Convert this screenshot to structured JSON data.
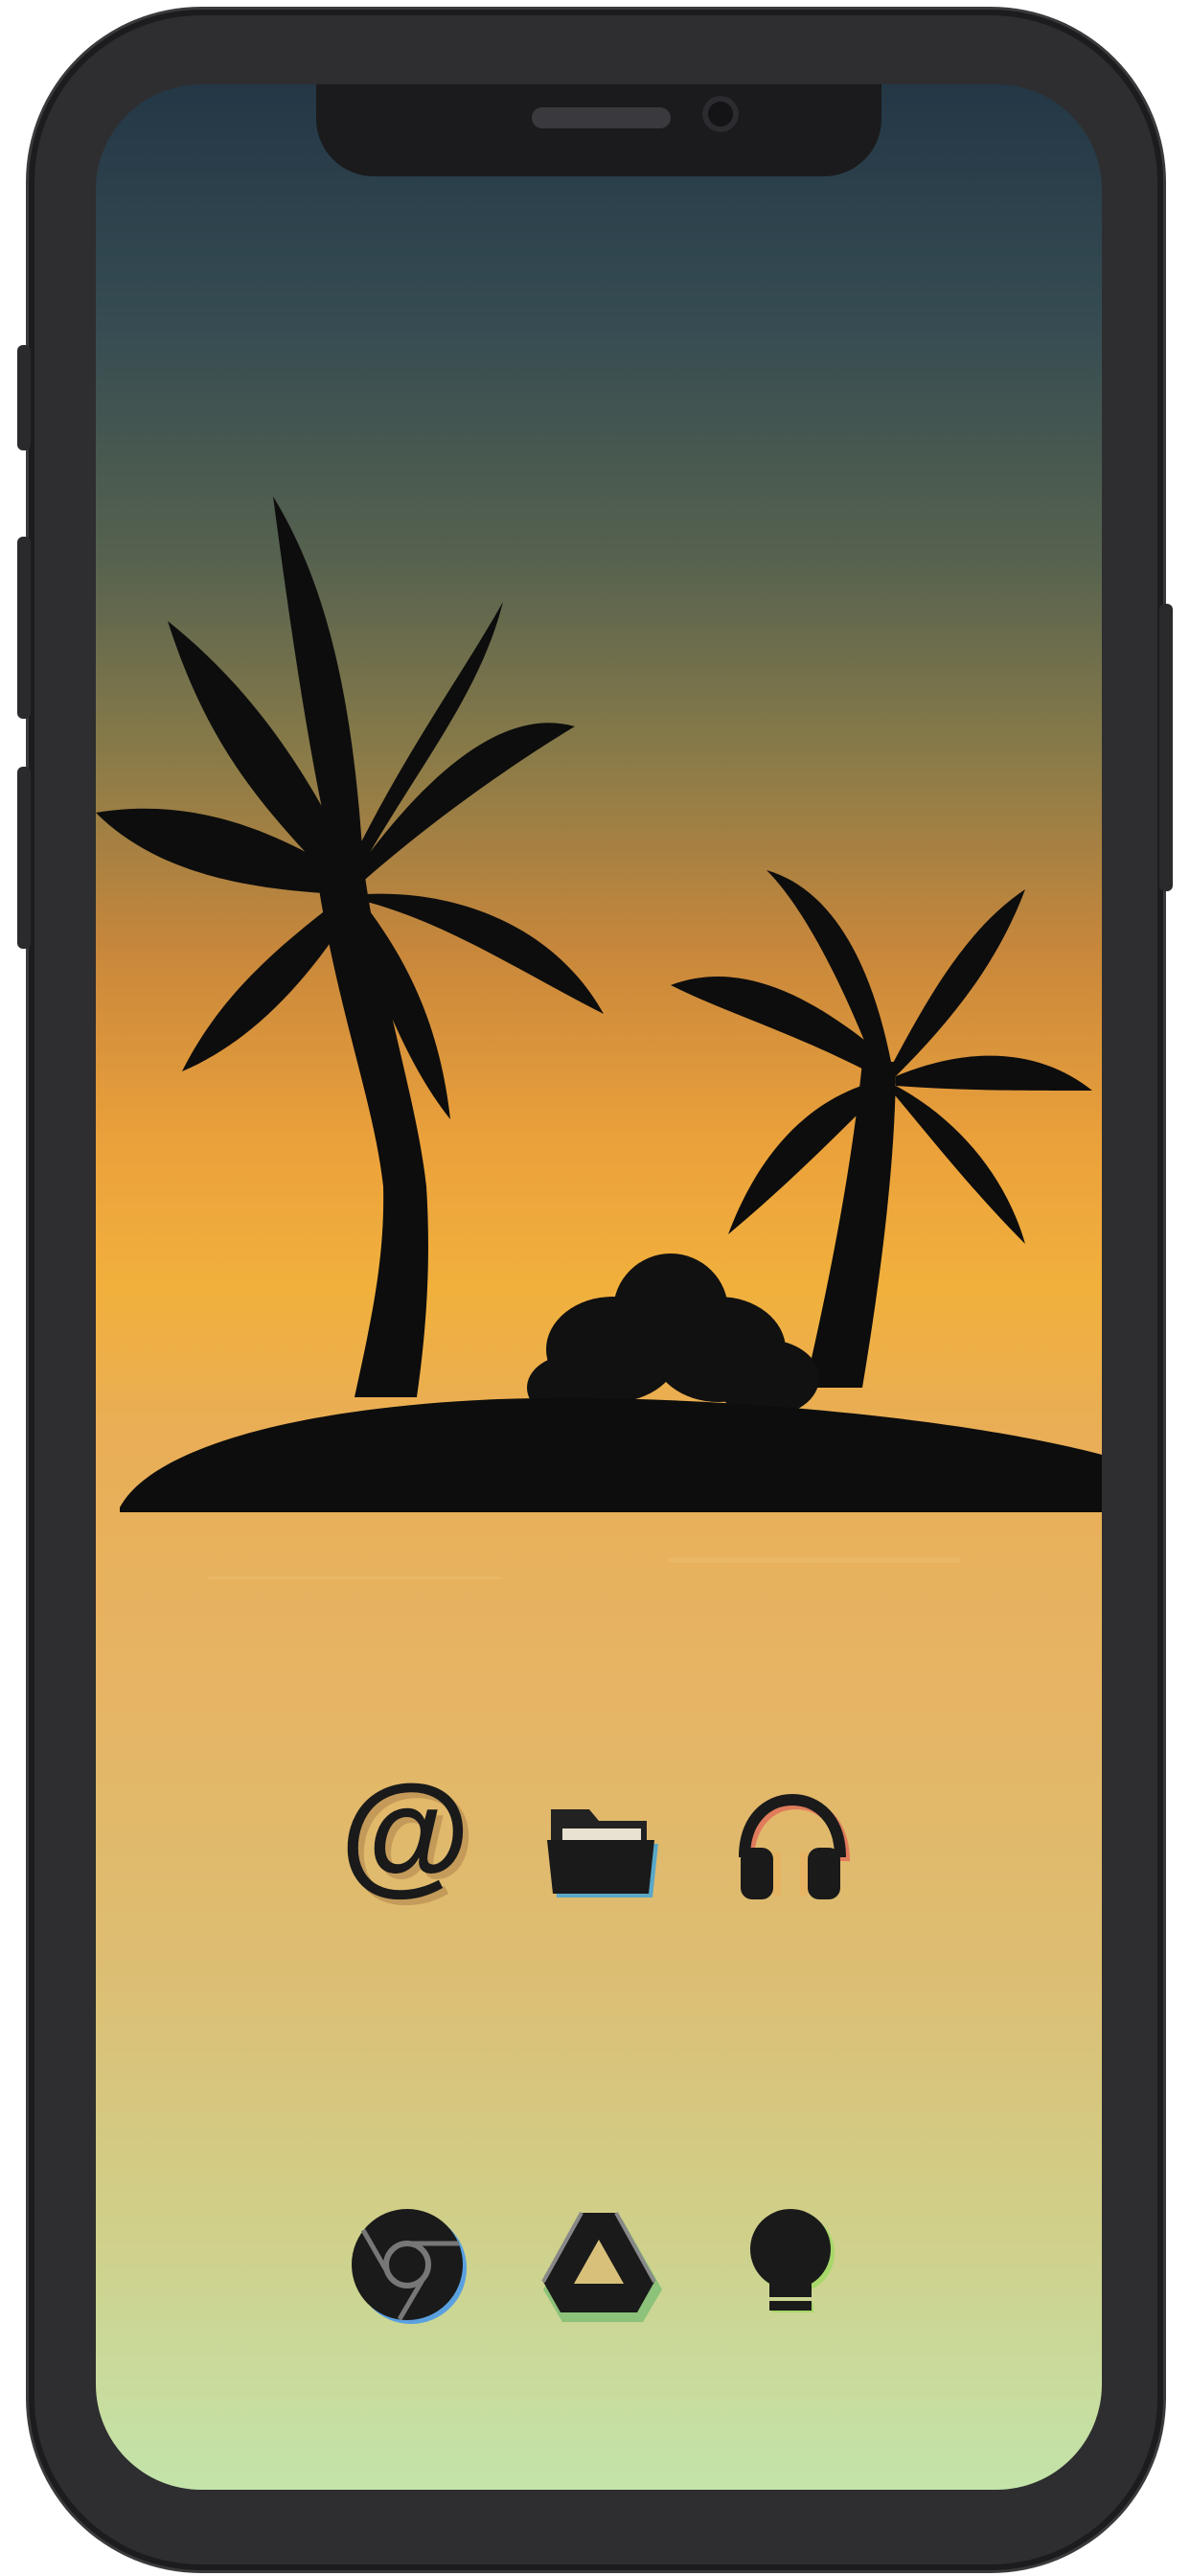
{
  "device": {
    "model": "phone-frame",
    "frame_color": "#2e2e30"
  },
  "wallpaper": {
    "theme": "tropical-island-sunset",
    "colors": {
      "sky_top": "#233746",
      "sky_mid": "#eba13b",
      "sea": "#e6b463",
      "sea_bottom": "#c3e4aa",
      "silhouette": "#0d0d0d"
    }
  },
  "home_screen": {
    "apps": [
      {
        "icon": "at-sign-icon",
        "row": 1,
        "col": 1
      },
      {
        "icon": "folder-icon",
        "row": 1,
        "col": 2
      },
      {
        "icon": "headphones-icon",
        "row": 1,
        "col": 3
      },
      {
        "icon": "chrome-icon",
        "row": 2,
        "col": 1
      },
      {
        "icon": "drive-icon",
        "row": 2,
        "col": 2
      },
      {
        "icon": "lightbulb-icon",
        "row": 2,
        "col": 3
      }
    ]
  }
}
